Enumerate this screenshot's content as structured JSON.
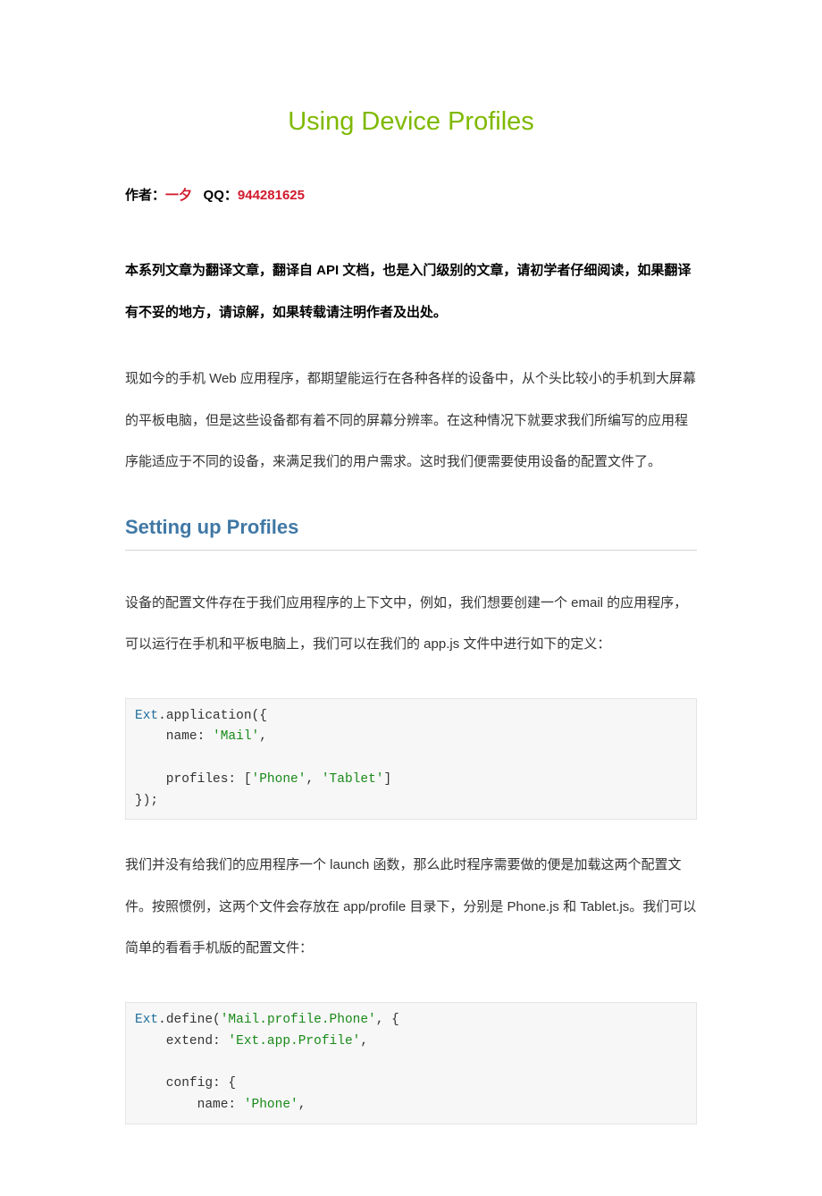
{
  "title": "Using Device Profiles",
  "author": {
    "label_prefix": "作者：",
    "name": "一夕",
    "qq_label": "QQ：",
    "qq": "944281625"
  },
  "disclaimer": "本系列文章为翻译文章，翻译自 API 文档，也是入门级别的文章，请初学者仔细阅读，如果翻译有不妥的地方，请谅解，如果转载请注明作者及出处。",
  "intro": "现如今的手机 Web 应用程序，都期望能运行在各种各样的设备中，从个头比较小的手机到大屏幕的平板电脑，但是这些设备都有着不同的屏幕分辨率。在这种情况下就要求我们所编写的应用程序能适应于不同的设备，来满足我们的用户需求。这时我们便需要使用设备的配置文件了。",
  "section1": {
    "heading": "Setting up Profiles",
    "para1": "设备的配置文件存在于我们应用程序的上下文中，例如，我们想要创建一个 email 的应用程序，可以运行在手机和平板电脑上，我们可以在我们的 app.js 文件中进行如下的定义：",
    "code1": {
      "ns": "Ext",
      "dot1": ".",
      "fn": "application",
      "open1": "({",
      "line2": "    name",
      "colon1": ": ",
      "str1": "'Mail'",
      "comma1": ",",
      "line3": "    profiles",
      "colon2": ": ",
      "arr_open": "[",
      "str2": "'Phone'",
      "comma2": ", ",
      "str3": "'Tablet'",
      "arr_close": "]",
      "close": "});"
    },
    "para2": "我们并没有给我们的应用程序一个 launch 函数，那么此时程序需要做的便是加载这两个配置文件。按照惯例，这两个文件会存放在 app/profile 目录下，分别是 Phone.js 和 Tablet.js。我们可以简单的看看手机版的配置文件：",
    "code2": {
      "ns": "Ext",
      "dot1": ".",
      "fn": "define",
      "open_paren": "(",
      "str_class": "'Mail.profile.Phone'",
      "comma0": ", ",
      "brace0": "{",
      "line_ext": "    extend",
      "colon_ext": ": ",
      "str_ext": "'Ext.app.Profile'",
      "comma_ext": ",",
      "line_cfg": "    config",
      "colon_cfg": ": ",
      "brace_cfg": "{",
      "line_name": "        name",
      "colon_name": ": ",
      "str_name": "'Phone'",
      "comma_name": ","
    }
  }
}
